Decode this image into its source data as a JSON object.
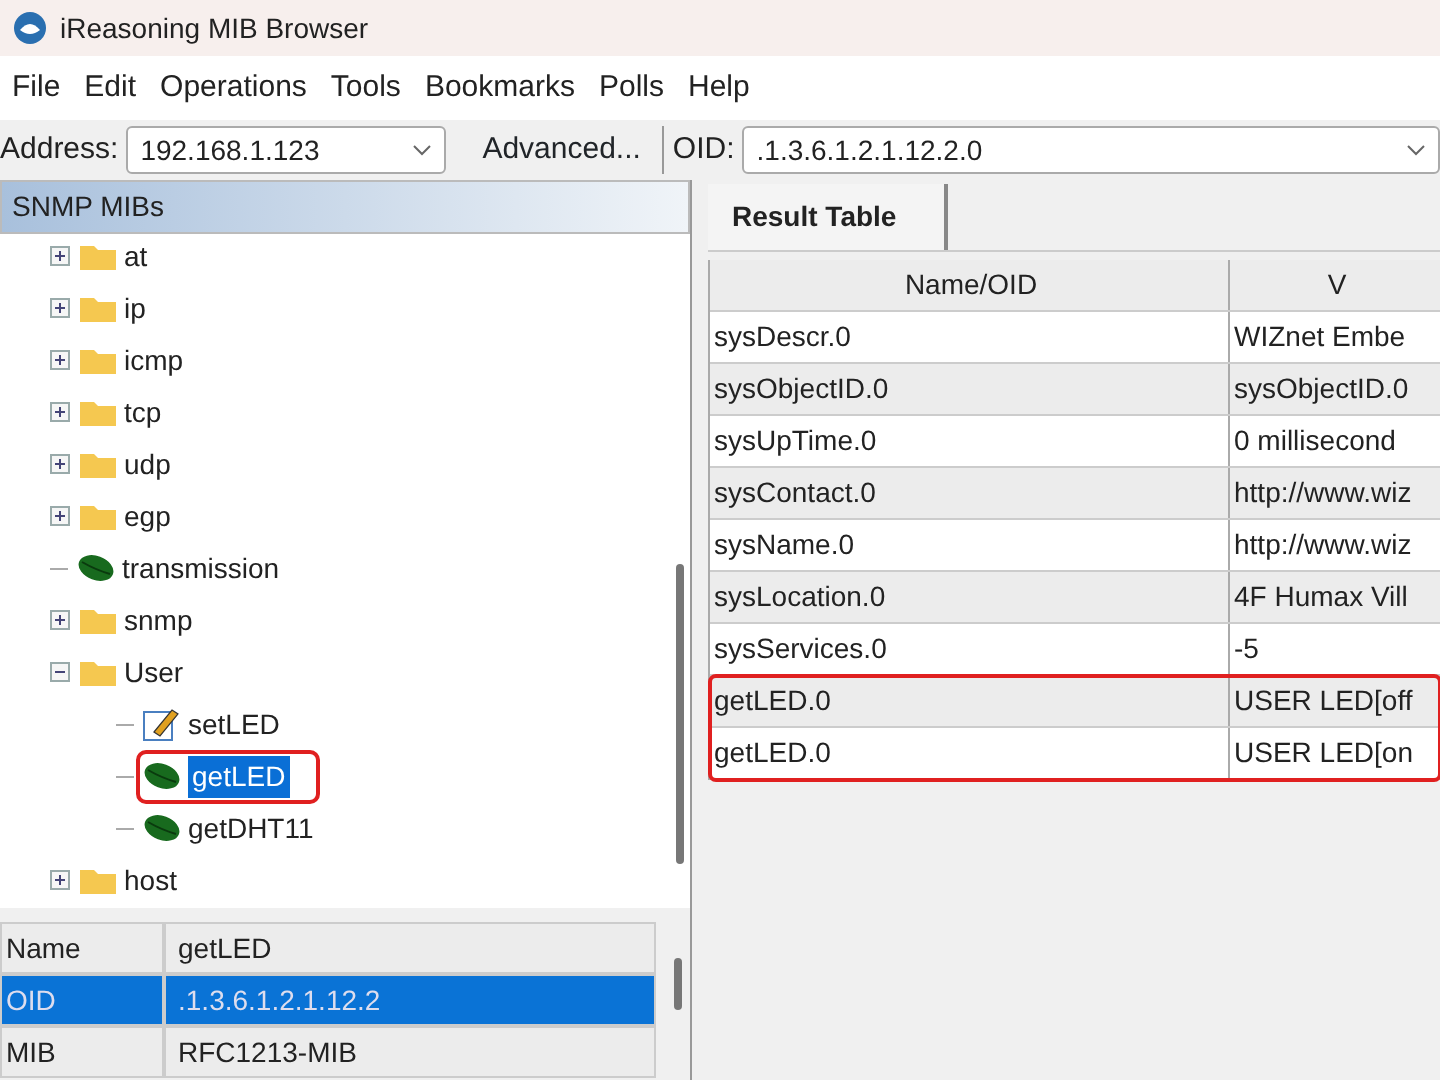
{
  "window": {
    "title": "iReasoning MIB Browser"
  },
  "menu": [
    "File",
    "Edit",
    "Operations",
    "Tools",
    "Bookmarks",
    "Polls",
    "Help"
  ],
  "toolbar": {
    "address_label": "Address:",
    "address": "192.168.1.123",
    "advanced_button": "Advanced...",
    "oid_label": "OID:",
    "oid": ".1.3.6.1.2.1.12.2.0"
  },
  "tree": {
    "title": "SNMP MIBs",
    "items": [
      {
        "label": "at",
        "kind": "folder",
        "expanded": false
      },
      {
        "label": "ip",
        "kind": "folder",
        "expanded": false
      },
      {
        "label": "icmp",
        "kind": "folder",
        "expanded": false
      },
      {
        "label": "tcp",
        "kind": "folder",
        "expanded": false
      },
      {
        "label": "udp",
        "kind": "folder",
        "expanded": false
      },
      {
        "label": "egp",
        "kind": "folder",
        "expanded": false
      },
      {
        "label": "transmission",
        "kind": "leaf"
      },
      {
        "label": "snmp",
        "kind": "folder",
        "expanded": false
      },
      {
        "label": "User",
        "kind": "folder",
        "expanded": true,
        "children": [
          {
            "label": "setLED",
            "kind": "writable",
            "selected": false,
            "highlighted": false
          },
          {
            "label": "getLED",
            "kind": "leaf",
            "selected": true,
            "highlighted": true
          },
          {
            "label": "getDHT11",
            "kind": "leaf",
            "selected": false,
            "highlighted": false
          }
        ]
      },
      {
        "label": "host",
        "kind": "folder",
        "expanded": false
      }
    ]
  },
  "properties": [
    {
      "name": "Name",
      "value": "getLED",
      "selected": false
    },
    {
      "name": "OID",
      "value": ".1.3.6.1.2.1.12.2",
      "selected": true
    },
    {
      "name": "MIB",
      "value": "RFC1213-MIB",
      "selected": false
    }
  ],
  "result": {
    "tab": "Result Table",
    "columns": [
      "Name/OID",
      "V"
    ],
    "rows": [
      {
        "name": "sysDescr.0",
        "value": "WIZnet Embe",
        "highlighted": false
      },
      {
        "name": "sysObjectID.0",
        "value": "sysObjectID.0",
        "highlighted": false
      },
      {
        "name": "sysUpTime.0",
        "value": "0 millisecond",
        "highlighted": false
      },
      {
        "name": "sysContact.0",
        "value": "http://www.wiz",
        "highlighted": false
      },
      {
        "name": "sysName.0",
        "value": "http://www.wiz",
        "highlighted": false
      },
      {
        "name": "sysLocation.0",
        "value": "4F Humax Vill",
        "highlighted": false
      },
      {
        "name": "sysServices.0",
        "value": "-5",
        "highlighted": false
      },
      {
        "name": "getLED.0",
        "value": "USER LED[off",
        "highlighted": true
      },
      {
        "name": "getLED.0",
        "value": "USER LED[on",
        "highlighted": true
      }
    ]
  }
}
